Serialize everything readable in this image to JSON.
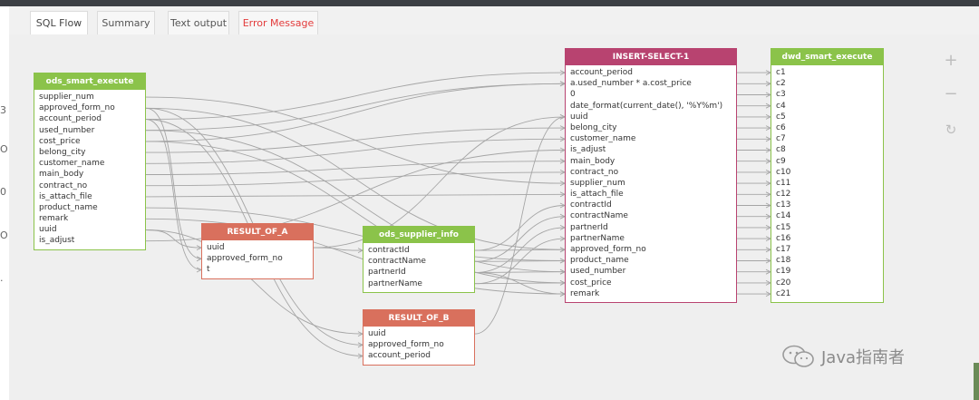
{
  "tabs": [
    {
      "label": "SQL Flow",
      "active": true
    },
    {
      "label": "Summary",
      "active": false
    },
    {
      "label": "Text output",
      "active": false
    },
    {
      "label": "Error Message",
      "active": false,
      "color": "#e33b3b"
    }
  ],
  "nodes": {
    "ods_smart_execute": {
      "title": "ods_smart_execute",
      "columns": [
        "supplier_num",
        "approved_form_no",
        "account_period",
        "used_number",
        "cost_price",
        "belong_city",
        "customer_name",
        "main_body",
        "contract_no",
        "is_attach_file",
        "product_name",
        "remark",
        "uuid",
        "is_adjust"
      ]
    },
    "result_of_a": {
      "title": "RESULT_OF_A",
      "columns": [
        "uuid",
        "approved_form_no",
        "t"
      ]
    },
    "ods_supplier_info": {
      "title": "ods_supplier_info",
      "columns": [
        "contractId",
        "contractName",
        "partnerId",
        "partnerName"
      ]
    },
    "result_of_b": {
      "title": "RESULT_OF_B",
      "columns": [
        "uuid",
        "approved_form_no",
        "account_period"
      ]
    },
    "insert_select_1": {
      "title": "INSERT-SELECT-1",
      "columns": [
        "account_period",
        "a.used_number * a.cost_price",
        "0",
        "date_format(current_date(), '%Y%m')",
        "uuid",
        "belong_city",
        "customer_name",
        "is_adjust",
        "main_body",
        "contract_no",
        "supplier_num",
        "is_attach_file",
        "contractId",
        "contractName",
        "partnerId",
        "partnerName",
        "approved_form_no",
        "product_name",
        "used_number",
        "cost_price",
        "remark"
      ]
    },
    "dwd_smart_execute": {
      "title": "dwd_smart_execute",
      "columns": [
        "c1",
        "c2",
        "c3",
        "c4",
        "c5",
        "c6",
        "c7",
        "c8",
        "c9",
        "c10",
        "c11",
        "c12",
        "c13",
        "c14",
        "c15",
        "c16",
        "c17",
        "c18",
        "c19",
        "c20",
        "c21"
      ]
    }
  },
  "controls": {
    "zoom_in": "+",
    "zoom_out": "−",
    "reset": "↻"
  },
  "left_marks": [
    "3",
    "O",
    "0",
    "O",
    "."
  ],
  "watermark": {
    "text": "Java指南者",
    "icon": "wechat-icon"
  },
  "colors": {
    "green": "#8bc34a",
    "red": "#d9705d",
    "magenta": "#b84370",
    "error": "#e33b3b"
  }
}
